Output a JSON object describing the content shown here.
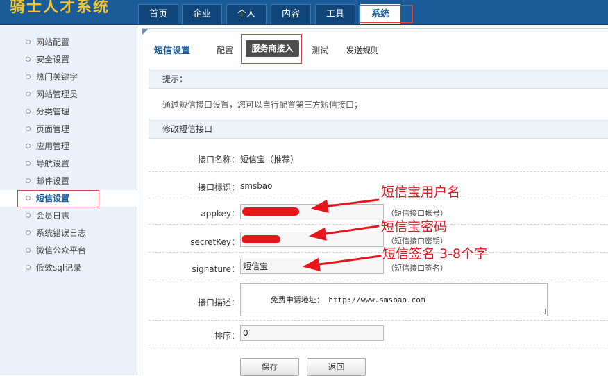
{
  "app": {
    "brand": "骑士人才系统"
  },
  "nav": {
    "tabs": [
      {
        "label": "首页"
      },
      {
        "label": "企业"
      },
      {
        "label": "个人"
      },
      {
        "label": "内容"
      },
      {
        "label": "工具"
      },
      {
        "label": "系统",
        "active": true
      }
    ]
  },
  "sidebar": {
    "items": [
      {
        "label": "网站配置"
      },
      {
        "label": "安全设置"
      },
      {
        "label": "热门关键字"
      },
      {
        "label": "网站管理员"
      },
      {
        "label": "分类管理"
      },
      {
        "label": "页面管理"
      },
      {
        "label": "应用管理"
      },
      {
        "label": "导航设置"
      },
      {
        "label": "邮件设置"
      },
      {
        "label": "短信设置",
        "active": true
      },
      {
        "label": "会员日志"
      },
      {
        "label": "系统错误日志"
      },
      {
        "label": "微信公众平台"
      },
      {
        "label": "低效sql记录"
      }
    ]
  },
  "subnav": {
    "title": "短信设置",
    "tabs": [
      {
        "label": "配置"
      },
      {
        "label": "服务商接入",
        "active": true
      },
      {
        "label": "测试"
      },
      {
        "label": "发送规则"
      }
    ]
  },
  "hint": {
    "heading": "提示：",
    "text": "通过短信接口设置，您可以自行配置第三方短信接口；"
  },
  "form": {
    "heading": "修改短信接口",
    "name_label": "接口名称：",
    "name_value": "短信宝（推荐）",
    "id_label": "接口标识：",
    "id_value": "smsbao",
    "appkey_label": "appkey：",
    "appkey_hint": "（短信接口帐号）",
    "secret_label": "secretKey：",
    "secret_hint": "（短信接口密钥）",
    "signature_label": "signature：",
    "signature_value": "短信宝",
    "signature_hint": "（短信接口签名）",
    "desc_label": "接口描述：",
    "desc_value": "免费申请地址： http://www.smsbao.com",
    "order_label": "排序：",
    "order_value": "0",
    "save_label": "保存",
    "back_label": "返回"
  },
  "annotations": {
    "username": "短信宝用户名",
    "password": "短信宝密码",
    "signature": "短信签名 3-8个字"
  },
  "colors": {
    "topbar": "#1a5b9a",
    "brand": "#f4c430",
    "highlight_box": "#e04040",
    "annotation": "#e8151d"
  }
}
